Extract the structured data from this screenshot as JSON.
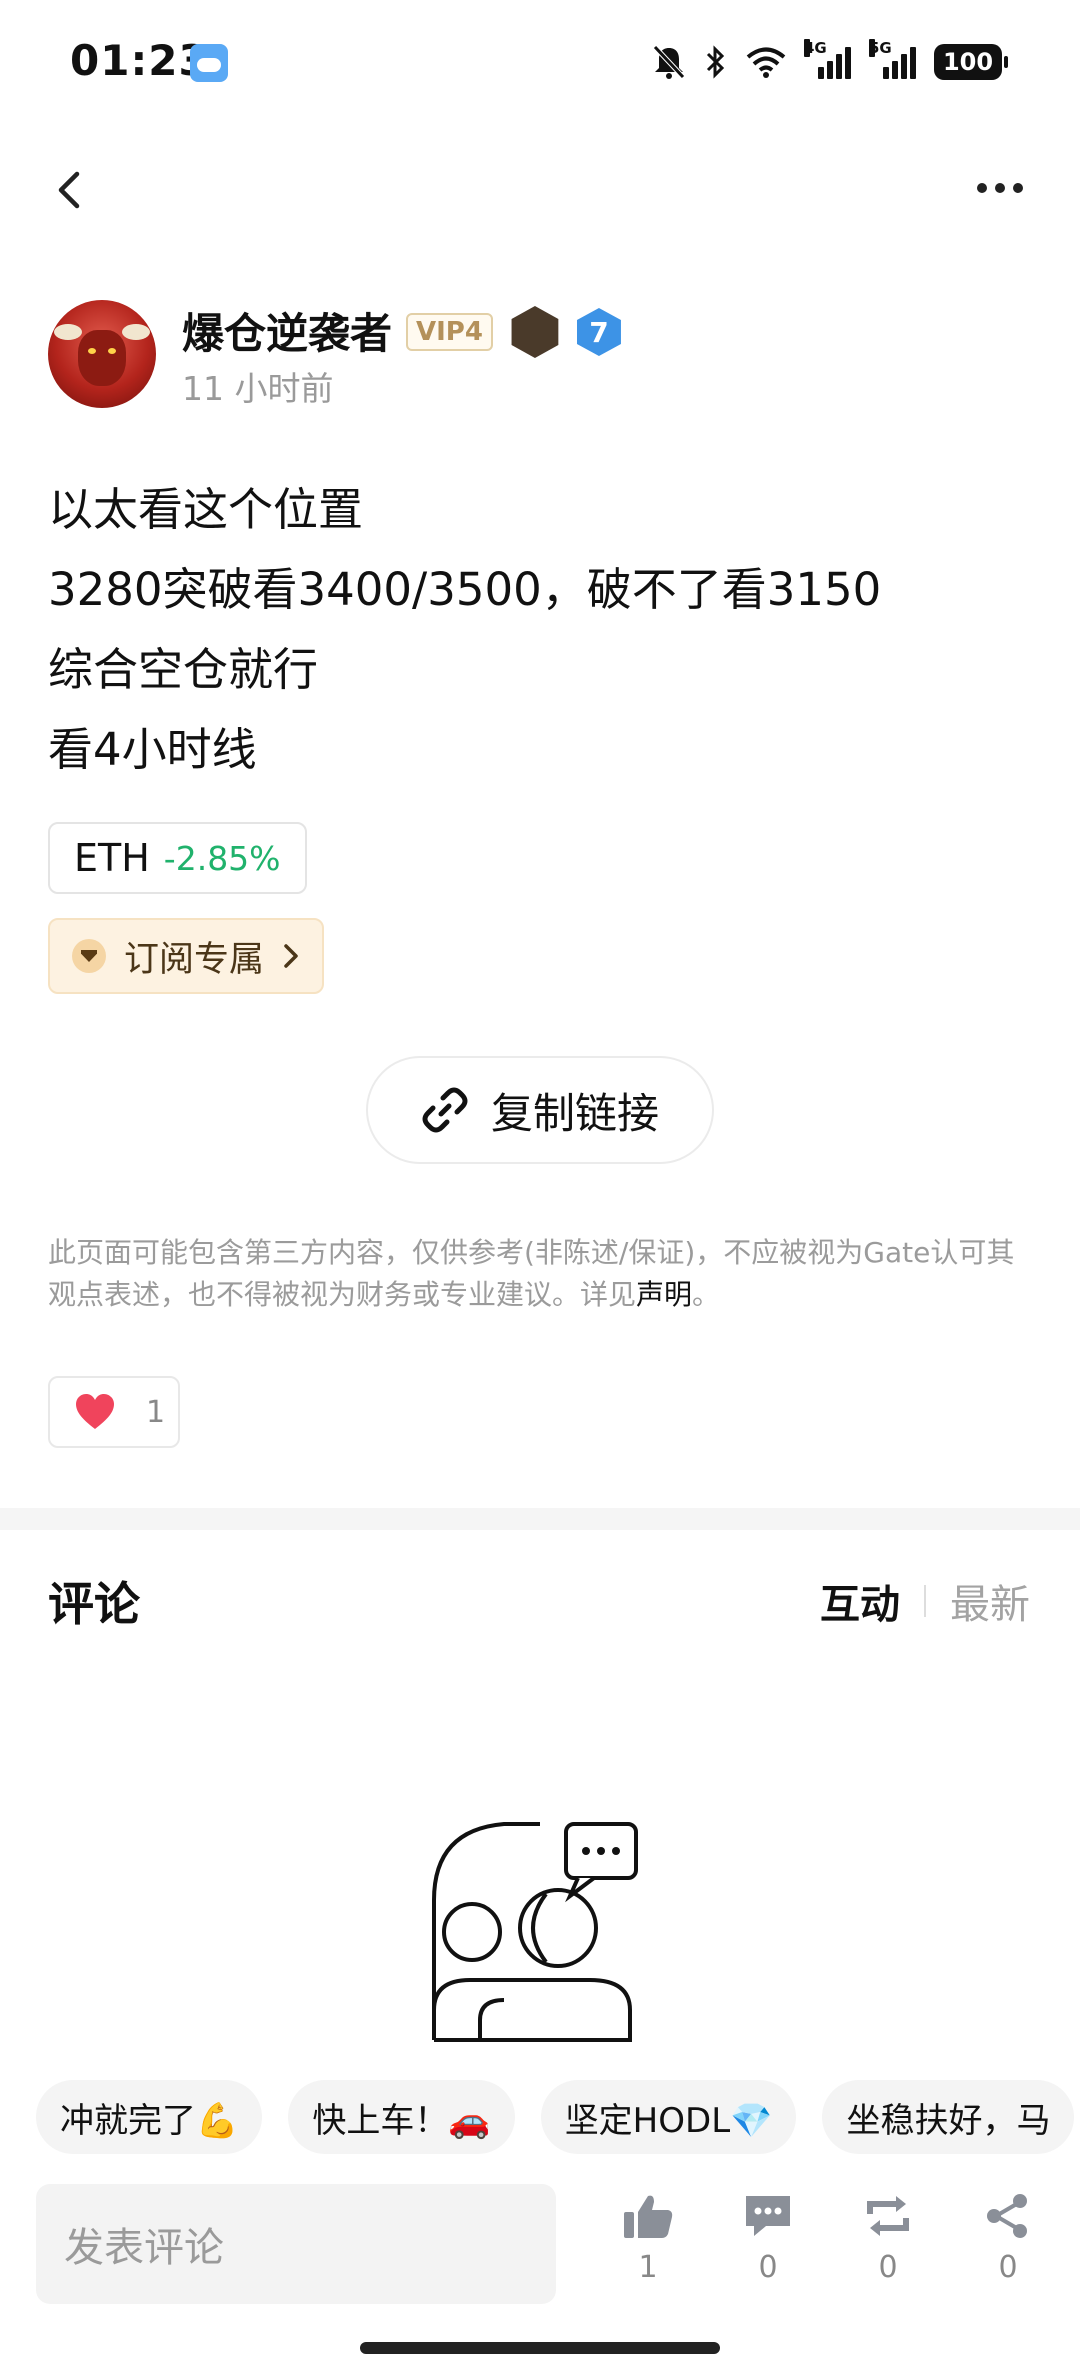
{
  "status_bar": {
    "time": "01:23",
    "network_1": "4G",
    "network_2": "5G",
    "battery": "100",
    "icons": [
      "weather-icon",
      "bell-off-icon",
      "bluetooth-icon",
      "wifi-icon",
      "signal-icon",
      "signal-icon",
      "battery-icon"
    ]
  },
  "header": {
    "back_icon": "chevron-left-icon",
    "more_icon": "more-horizontal-icon"
  },
  "author": {
    "name": "爆仓逆袭者",
    "vip_badge": "VIP4",
    "level_badge": "7",
    "post_time": "11 小时前"
  },
  "post": {
    "lines": [
      "以太看这个位置",
      "3280突破看3400/3500，破不了看3150",
      "综合空仓就行",
      "看4小时线"
    ],
    "ticker": {
      "symbol": "ETH",
      "change": "-2.85%",
      "change_color": "#20b26c"
    },
    "subscribe_label": "订阅专属",
    "copy_link_label": "复制链接"
  },
  "disclaimer": {
    "text": "此页面可能包含第三方内容，仅供参考(非陈述/保证)，不应被视为Gate认可其观点表述，也不得被视为财务或专业建议。详见",
    "link": "声明",
    "end": "。"
  },
  "like": {
    "count": "1"
  },
  "comments": {
    "title": "评论",
    "sort_active": "互动",
    "sort_inactive": "最新"
  },
  "quick_replies": [
    "冲就完了💪",
    "快上车！🚗",
    "坚定HODL💎",
    "坐稳扶好，马"
  ],
  "bottom_bar": {
    "input_placeholder": "发表评论",
    "likes": "1",
    "comments": "0",
    "reposts": "0",
    "shares": "0"
  }
}
